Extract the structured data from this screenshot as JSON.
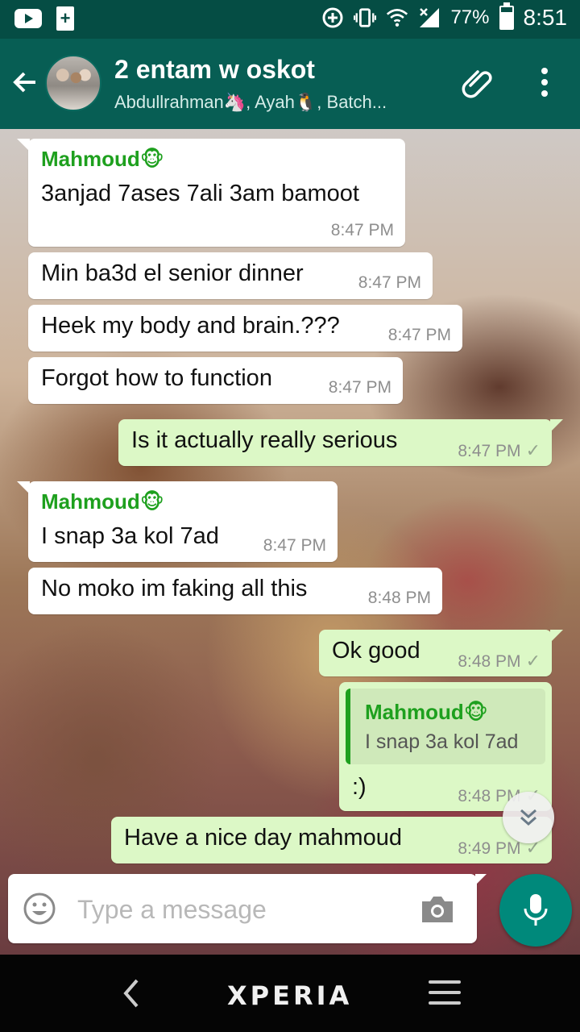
{
  "status_bar": {
    "battery_pct": "77%",
    "time": "8:51",
    "battery_level": 0.77
  },
  "header": {
    "title": "2 entam w oskot",
    "subtitle": "Abdullrahman🦄, Ayah🐧, Batch..."
  },
  "messages": [
    {
      "dir": "in",
      "sender": "Mahmoud🐵",
      "text": "3anjad 7ases 7ali 3am bamoot",
      "time": "8:47 PM"
    },
    {
      "dir": "in",
      "sender": "",
      "text": "Min ba3d el senior dinner",
      "time": "8:47 PM"
    },
    {
      "dir": "in",
      "sender": "",
      "text": "Heek my body and brain.???",
      "time": "8:47 PM"
    },
    {
      "dir": "in",
      "sender": "",
      "text": "Forgot how to function",
      "time": "8:47 PM"
    },
    {
      "dir": "out",
      "sender": "",
      "text": "Is it actually really serious",
      "time": "8:47 PM"
    },
    {
      "dir": "in",
      "sender": "Mahmoud🐵",
      "text": "I snap 3a kol 7ad",
      "time": "8:47 PM"
    },
    {
      "dir": "in",
      "sender": "",
      "text": "No moko im faking all this",
      "time": "8:48 PM"
    },
    {
      "dir": "out",
      "sender": "",
      "text": "Ok good",
      "time": "8:48 PM"
    },
    {
      "dir": "out",
      "sender": "",
      "text": ":)",
      "time": "8:48 PM",
      "quote": {
        "sender": "Mahmoud🐵",
        "text": "I snap 3a kol 7ad"
      }
    },
    {
      "dir": "out",
      "sender": "",
      "text": "Have a nice day mahmoud",
      "time": "8:49 PM"
    }
  ],
  "input": {
    "placeholder": "Type a message"
  },
  "navbar": {
    "brand": "XPERIA"
  },
  "colors": {
    "header": "#075e54",
    "statusbar": "#054d44",
    "outgoing": "#dcf8c6",
    "sender": "#1ea01e",
    "mic": "#00897b"
  },
  "icons": [
    "youtube-icon",
    "battery-saver-icon",
    "data-saver-icon",
    "vibrate-icon",
    "wifi-icon",
    "signal-icon",
    "battery-icon",
    "back-arrow-icon",
    "attach-icon",
    "more-vert-icon",
    "emoji-icon",
    "camera-icon",
    "mic-icon",
    "scroll-down-icon",
    "nav-back-icon",
    "nav-menu-icon"
  ]
}
